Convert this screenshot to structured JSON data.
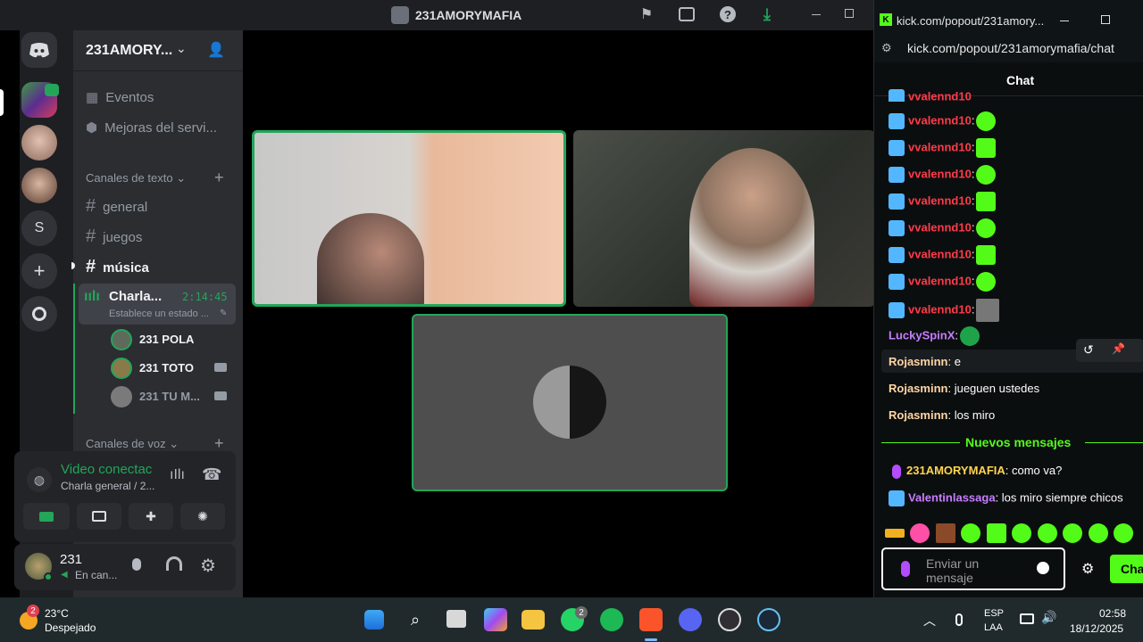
{
  "window": {
    "title": "231AMORYMAFIA"
  },
  "server": {
    "name": "231AMORY..."
  },
  "sidebar": {
    "events": "Eventos",
    "boosts": "Mejoras del servi...",
    "text_channels": "Canales de texto",
    "channels": [
      "general",
      "juegos",
      "música"
    ],
    "voice_channel": "Charla...",
    "voice_time": "2:14:45",
    "voice_status": "Establece un estado ...",
    "members": [
      "231 POLA",
      "231 TOTO",
      "231 TU M..."
    ],
    "voice_channels": "Canales de voz"
  },
  "connection": {
    "status": "Video conectac",
    "channel": "Charla general / 2..."
  },
  "user": {
    "name": "231",
    "status": "En can..."
  },
  "chat": {
    "tab_title": "kick.com/popout/231amory...",
    "url": "kick.com/popout/231amorymafia/chat",
    "header": "Chat",
    "repeat_user": "vvalennd10",
    "messages": [
      {
        "user": "LuckySpinX",
        "text": ""
      },
      {
        "user": "Rojasminn",
        "text": "e"
      },
      {
        "user": "Rojasminn",
        "text": "jueguen ustedes"
      },
      {
        "user": "Rojasminn",
        "text": "los miro"
      }
    ],
    "new_messages": "Nuevos mensajes",
    "after": [
      {
        "user": "231AMORYMAFIA",
        "text": "como va?"
      },
      {
        "user": "Valentinlassaga",
        "text": "los miro siempre chicos"
      }
    ],
    "input_placeholder": "Enviar un mensaje",
    "send_label": "Cha"
  },
  "taskbar": {
    "weather_temp": "23°C",
    "weather_desc": "Despejado",
    "weather_badge": "2",
    "whatsapp_badge": "2",
    "lang1": "ESP",
    "lang2": "LAA",
    "time": "02:58",
    "date": "18/12/2025"
  },
  "colors": {
    "kick_green": "#53fc18",
    "discord_green": "#23a55a",
    "red_user": "#ff3b4a"
  }
}
